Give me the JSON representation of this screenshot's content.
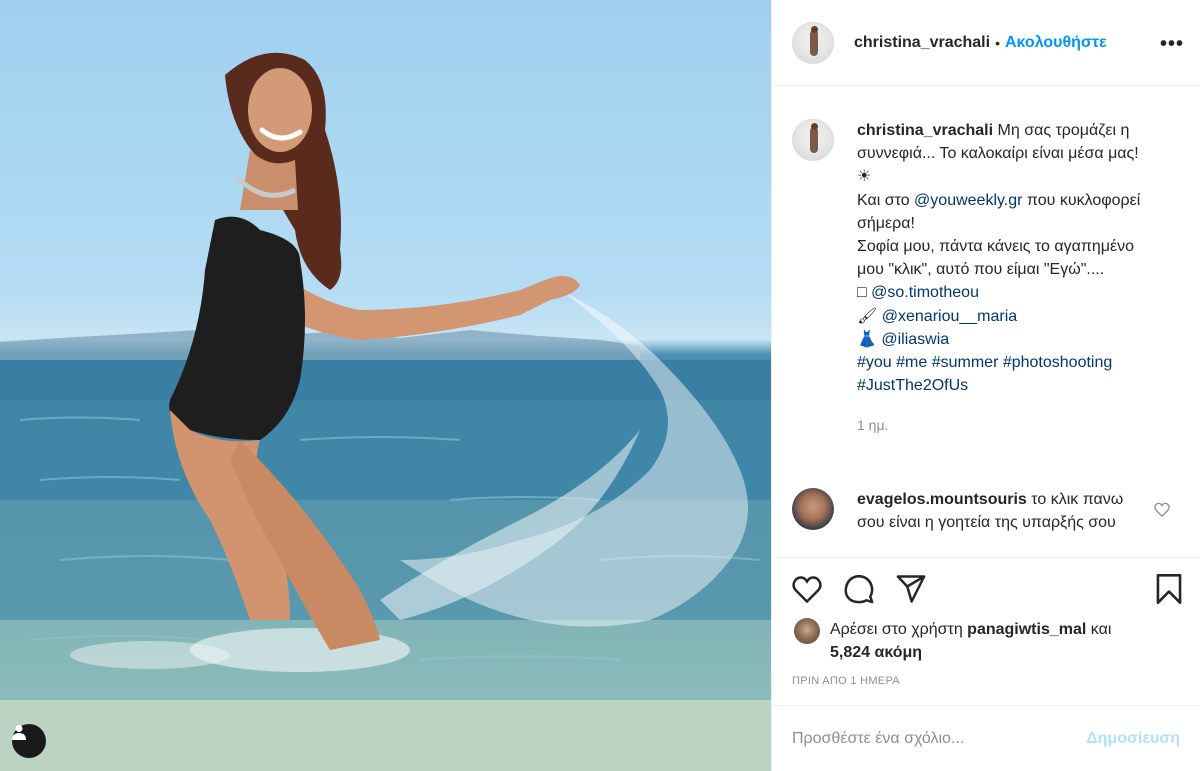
{
  "post": {
    "username": "christina_vrachali",
    "dot": "•",
    "follow_label": "Ακολουθήστε",
    "more_label": "•••"
  },
  "caption": {
    "username": "christina_vrachali",
    "line1": "Μη σας τρομάζει η συννεφιά... Το καλοκαίρι είναι μέσα μας! ☀",
    "line2_pre": "Και στο ",
    "line2_link": "@youweekly.gr",
    "line2_post": " που κυκλοφορεί σήμερα!",
    "line3": "Σοφία μου, πάντα κάνεις το αγαπημένο μου \"κλικ\", αυτό που είμαι \"Εγώ\"....",
    "credit1_icon": "□",
    "credit1": "@so.timotheou",
    "credit2_icon": "🖌",
    "credit2": "@xenariou__maria",
    "credit3_icon": "👗",
    "credit3": "@iliaswia",
    "hashtags": "#you #me #summer #photoshooting #JustThe2OfUs",
    "time": "1 ημ."
  },
  "comment": {
    "username": "evagelos.mountsouris",
    "text": "το κλικ πανω σου είναι η γοητεία της υπαρξής σου"
  },
  "actions": {
    "like_icon": "heart-icon",
    "comment_icon": "comment-icon",
    "share_icon": "paper-plane-icon",
    "save_icon": "bookmark-icon"
  },
  "likes": {
    "prefix": "Αρέσει στο χρήστη ",
    "user": "panagiwtis_mal",
    "middle": " και ",
    "count": "5,824 ακόμη"
  },
  "timestamp": "ΠΡΙΝ ΑΠΟ 1 ΗΜΕΡΑ",
  "add_comment": {
    "placeholder": "Προσθέστε ένα σχόλιο...",
    "post_label": "Δημοσίευση"
  },
  "colors": {
    "link": "#00376b",
    "accent": "#0095f6",
    "muted": "#8e8e8e",
    "post_disabled": "#b2dffc"
  }
}
